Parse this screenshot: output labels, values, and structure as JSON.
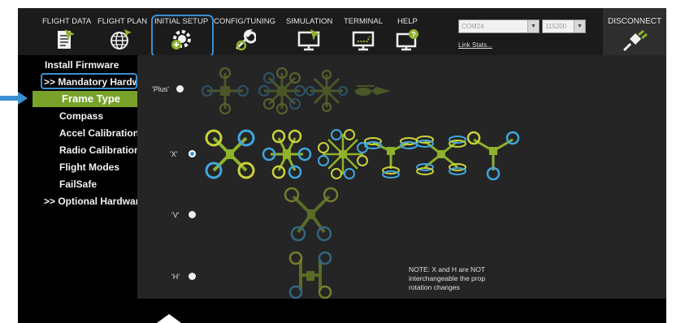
{
  "toolbar": {
    "items": [
      {
        "label": "FLIGHT DATA",
        "icon": "flight-data-icon"
      },
      {
        "label": "FLIGHT PLAN",
        "icon": "globe-icon"
      },
      {
        "label": "INITIAL SETUP",
        "icon": "gear-plus-icon"
      },
      {
        "label": "CONFIG/TUNING",
        "icon": "wrench-icon"
      },
      {
        "label": "SIMULATION",
        "icon": "monitor-plane-icon"
      },
      {
        "label": "TERMINAL",
        "icon": "terminal-icon"
      },
      {
        "label": "HELP",
        "icon": "help-monitor-icon"
      }
    ],
    "port": "COM24",
    "baud": "115200",
    "link_stats": "Link Stats...",
    "disconnect": "DISCONNECT"
  },
  "sidebar": {
    "items": [
      {
        "label": "Install Firmware"
      },
      {
        "label": ">> Mandatory Hardware"
      },
      {
        "label": "Frame Type",
        "selected": true
      },
      {
        "label": "Compass"
      },
      {
        "label": "Accel Calibration"
      },
      {
        "label": "Radio Calibration"
      },
      {
        "label": "Flight Modes"
      },
      {
        "label": "FailSafe"
      },
      {
        "label": ">> Optional Hardware"
      }
    ]
  },
  "frame_types": [
    {
      "label": "'Plus'",
      "selected": false
    },
    {
      "label": "'X'",
      "selected": true
    },
    {
      "label": "'V'",
      "selected": false
    },
    {
      "label": "'H'",
      "selected": false
    }
  ],
  "note": {
    "line1": "NOTE: X and H are NOT",
    "line2": "interchangeable the prop",
    "line3": "rotation changes"
  },
  "colors": {
    "accent": "#3a8fd1",
    "selected_bg": "#79a22b",
    "prop_yellow": "#c9d33a",
    "prop_blue": "#3fa7dd",
    "frame_green": "#8fb22c"
  }
}
